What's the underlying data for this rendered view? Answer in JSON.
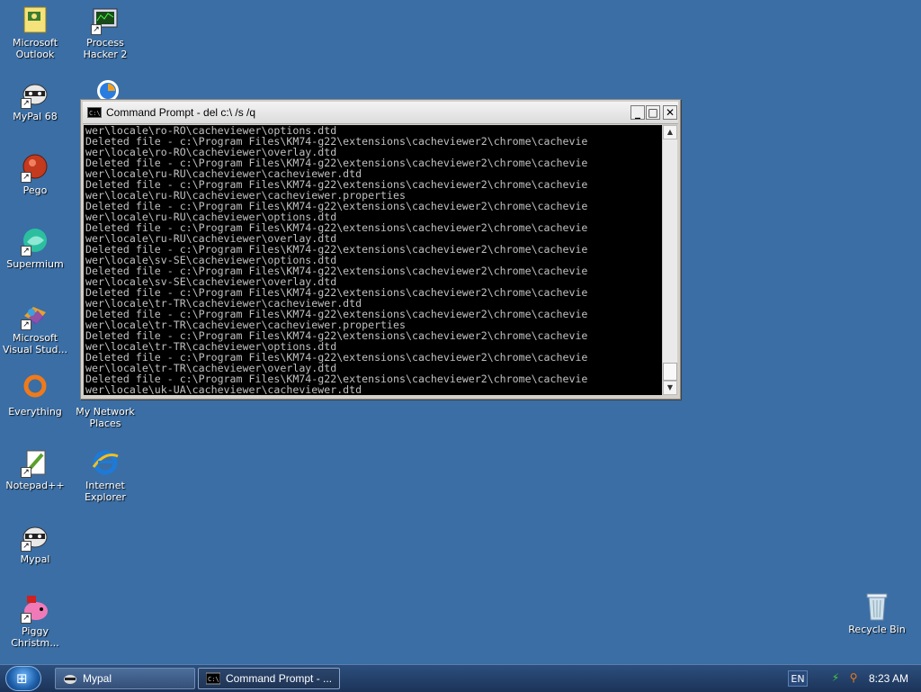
{
  "desktop": {
    "icons": [
      {
        "label": "Microsoft Outlook"
      },
      {
        "label": "Process Hacker 2"
      },
      {
        "label": "MyPal 68"
      },
      {
        "label": "Pego"
      },
      {
        "label": "Supermium"
      },
      {
        "label": "Microsoft Visual Stud..."
      },
      {
        "label": "Everything"
      },
      {
        "label": "My Network Places"
      },
      {
        "label": "Notepad++"
      },
      {
        "label": "Internet Explorer"
      },
      {
        "label": "Mypal"
      },
      {
        "label": "Piggy Christm..."
      },
      {
        "label": "Recycle Bin"
      }
    ]
  },
  "cmd_window": {
    "title": "Command Prompt - del c:\\ /s /q",
    "buttons": {
      "minimize": "_",
      "maximize": "□",
      "close": "✕"
    },
    "lines": [
      "wer\\locale\\ro-RO\\cacheviewer\\options.dtd",
      "Deleted file - c:\\Program Files\\KM74-g22\\extensions\\cacheviewer2\\chrome\\cachevie",
      "wer\\locale\\ro-RO\\cacheviewer\\overlay.dtd",
      "Deleted file - c:\\Program Files\\KM74-g22\\extensions\\cacheviewer2\\chrome\\cachevie",
      "wer\\locale\\ru-RU\\cacheviewer\\cacheviewer.dtd",
      "Deleted file - c:\\Program Files\\KM74-g22\\extensions\\cacheviewer2\\chrome\\cachevie",
      "wer\\locale\\ru-RU\\cacheviewer\\cacheviewer.properties",
      "Deleted file - c:\\Program Files\\KM74-g22\\extensions\\cacheviewer2\\chrome\\cachevie",
      "wer\\locale\\ru-RU\\cacheviewer\\options.dtd",
      "Deleted file - c:\\Program Files\\KM74-g22\\extensions\\cacheviewer2\\chrome\\cachevie",
      "wer\\locale\\ru-RU\\cacheviewer\\overlay.dtd",
      "Deleted file - c:\\Program Files\\KM74-g22\\extensions\\cacheviewer2\\chrome\\cachevie",
      "wer\\locale\\sv-SE\\cacheviewer\\options.dtd",
      "Deleted file - c:\\Program Files\\KM74-g22\\extensions\\cacheviewer2\\chrome\\cachevie",
      "wer\\locale\\sv-SE\\cacheviewer\\overlay.dtd",
      "Deleted file - c:\\Program Files\\KM74-g22\\extensions\\cacheviewer2\\chrome\\cachevie",
      "wer\\locale\\tr-TR\\cacheviewer\\cacheviewer.dtd",
      "Deleted file - c:\\Program Files\\KM74-g22\\extensions\\cacheviewer2\\chrome\\cachevie",
      "wer\\locale\\tr-TR\\cacheviewer\\cacheviewer.properties",
      "Deleted file - c:\\Program Files\\KM74-g22\\extensions\\cacheviewer2\\chrome\\cachevie",
      "wer\\locale\\tr-TR\\cacheviewer\\options.dtd",
      "Deleted file - c:\\Program Files\\KM74-g22\\extensions\\cacheviewer2\\chrome\\cachevie",
      "wer\\locale\\tr-TR\\cacheviewer\\overlay.dtd",
      "Deleted file - c:\\Program Files\\KM74-g22\\extensions\\cacheviewer2\\chrome\\cachevie",
      "wer\\locale\\uk-UA\\cacheviewer\\cacheviewer.dtd"
    ]
  },
  "taskbar": {
    "tasks": [
      {
        "label": "Mypal"
      },
      {
        "label": "Command Prompt - ..."
      }
    ],
    "language": "EN",
    "clock": "8:23 AM"
  },
  "colors": {
    "desktop": "#3a6ea5",
    "console_bg": "#000000",
    "console_text": "#c0c0c0"
  }
}
